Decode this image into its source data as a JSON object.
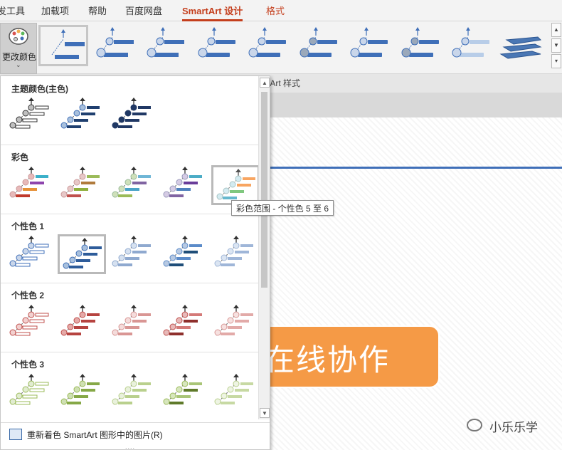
{
  "tabs": [
    {
      "label": "发工具"
    },
    {
      "label": "加载项"
    },
    {
      "label": "帮助"
    },
    {
      "label": "百度网盘"
    },
    {
      "label": "SmartArt 设计"
    },
    {
      "label": "格式"
    }
  ],
  "ribbon": {
    "change_color_label": "更改颜色",
    "group_label": "rtArt 样式",
    "gallery_selected_index": 0,
    "scroll_up": "▲",
    "scroll_down": "▼",
    "scroll_more": "▾"
  },
  "panel": {
    "sections": [
      {
        "title": "主题颜色(主色)"
      },
      {
        "title": "彩色"
      },
      {
        "title": "个性色 1"
      },
      {
        "title": "个性色 2"
      },
      {
        "title": "个性色 3"
      }
    ],
    "footer_text": "重新着色 SmartArt 图形中的图片(R)",
    "footer_grip": "....",
    "tooltip": "彩色范围 - 个性色 5 至 6"
  },
  "slide": {
    "title_text": "在线协作",
    "watermark": "小乐乐学"
  },
  "colors": {
    "accent_red": "#c43e1c",
    "blue": "#3f6fb8",
    "orange": "#f59a46"
  }
}
